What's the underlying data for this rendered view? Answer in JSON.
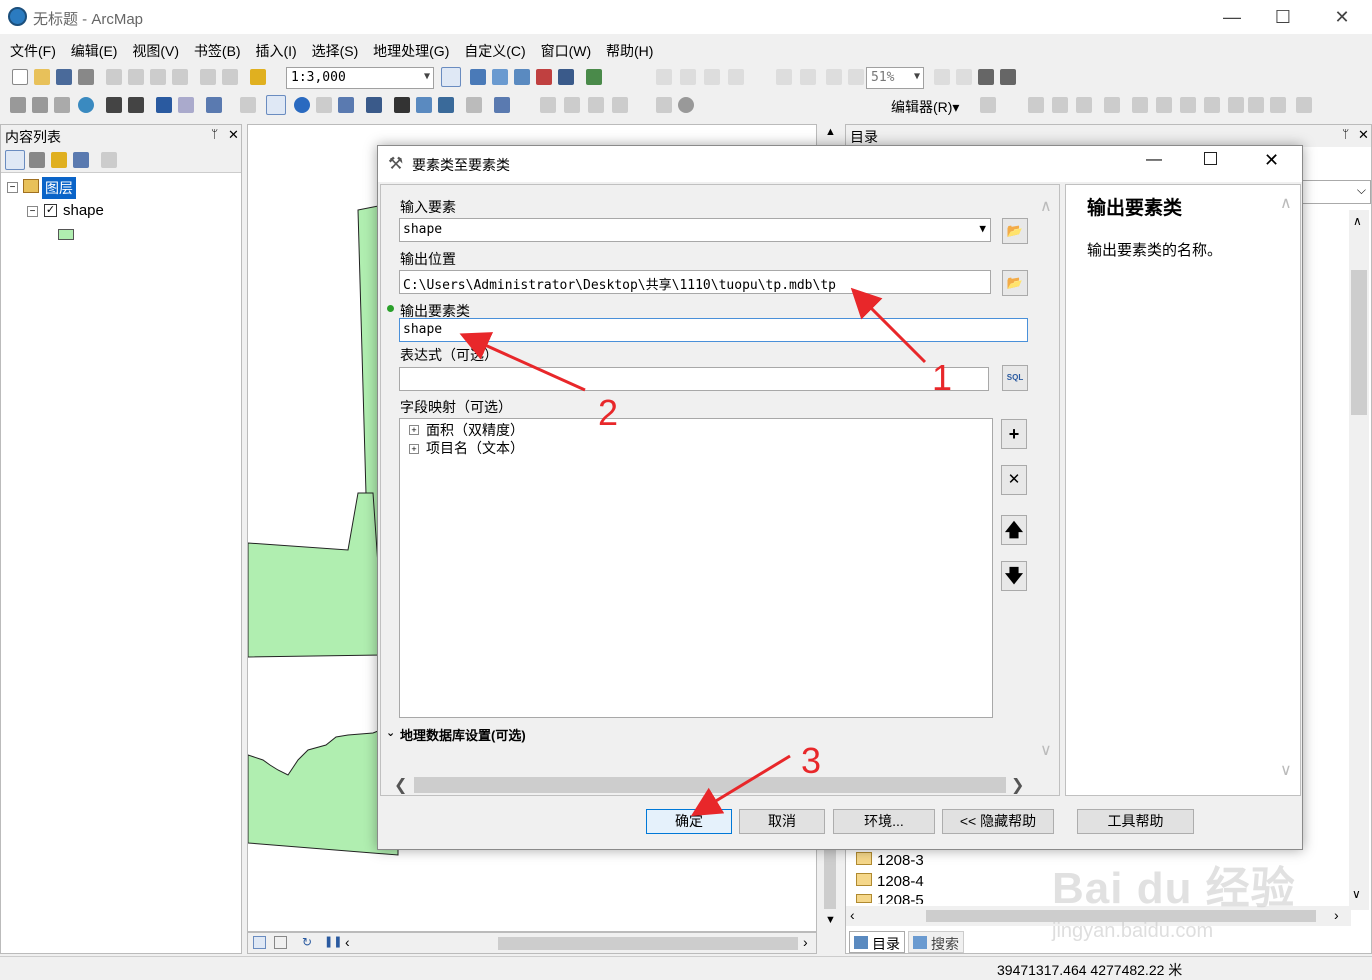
{
  "window": {
    "title": "无标题 - ArcMap",
    "min": "—",
    "max": "☐",
    "close": "✕"
  },
  "menu": [
    "文件(F)",
    "编辑(E)",
    "视图(V)",
    "书签(B)",
    "插入(I)",
    "选择(S)",
    "地理处理(G)",
    "自定义(C)",
    "窗口(W)",
    "帮助(H)"
  ],
  "toolbar": {
    "scale": "1:3,000",
    "zoom_pct": "51%",
    "editor_label": "编辑器(R)▾"
  },
  "toc": {
    "title": "内容列表",
    "pin": "ᛘ",
    "close": "✕",
    "root_layer": "图层",
    "layer": "shape",
    "layer_checked": true
  },
  "catalog": {
    "title": "目录",
    "folders": [
      "1208-3",
      "1208-4",
      "1208-5"
    ],
    "tabs": [
      "目录",
      "搜索"
    ]
  },
  "status": {
    "coords": "39471317.464  4277482.22 米"
  },
  "dialog": {
    "title": "要素类至要素类",
    "input_features_label": "输入要素",
    "input_features_value": "shape",
    "output_location_label": "输出位置",
    "output_location_value": "C:\\Users\\Administrator\\Desktop\\共享\\1110\\tuopu\\tp.mdb\\tp",
    "output_fc_label": "输出要素类",
    "output_fc_value": "shape",
    "expression_label": "表达式（可选）",
    "expression_value": "",
    "sql_label": "SQL",
    "field_map_label": "字段映射（可选）",
    "fields": [
      "面积（双精度）",
      "项目名（文本）"
    ],
    "geodb_settings_label": "地理数据库设置(可选)",
    "help_title": "输出要素类",
    "help_text": "输出要素类的名称。",
    "buttons": {
      "ok": "确定",
      "cancel": "取消",
      "env": "环境...",
      "hide_help": "<< 隐藏帮助",
      "tool_help": "工具帮助"
    }
  },
  "annotations": [
    "1",
    "2",
    "3"
  ],
  "watermark": {
    "brand": "Bai du 经验",
    "url": "jingyan.baidu.com"
  },
  "colors": {
    "polygon_fill": "#b0eeb0",
    "arrow": "#e8272a",
    "selection": "#0a64c8"
  }
}
